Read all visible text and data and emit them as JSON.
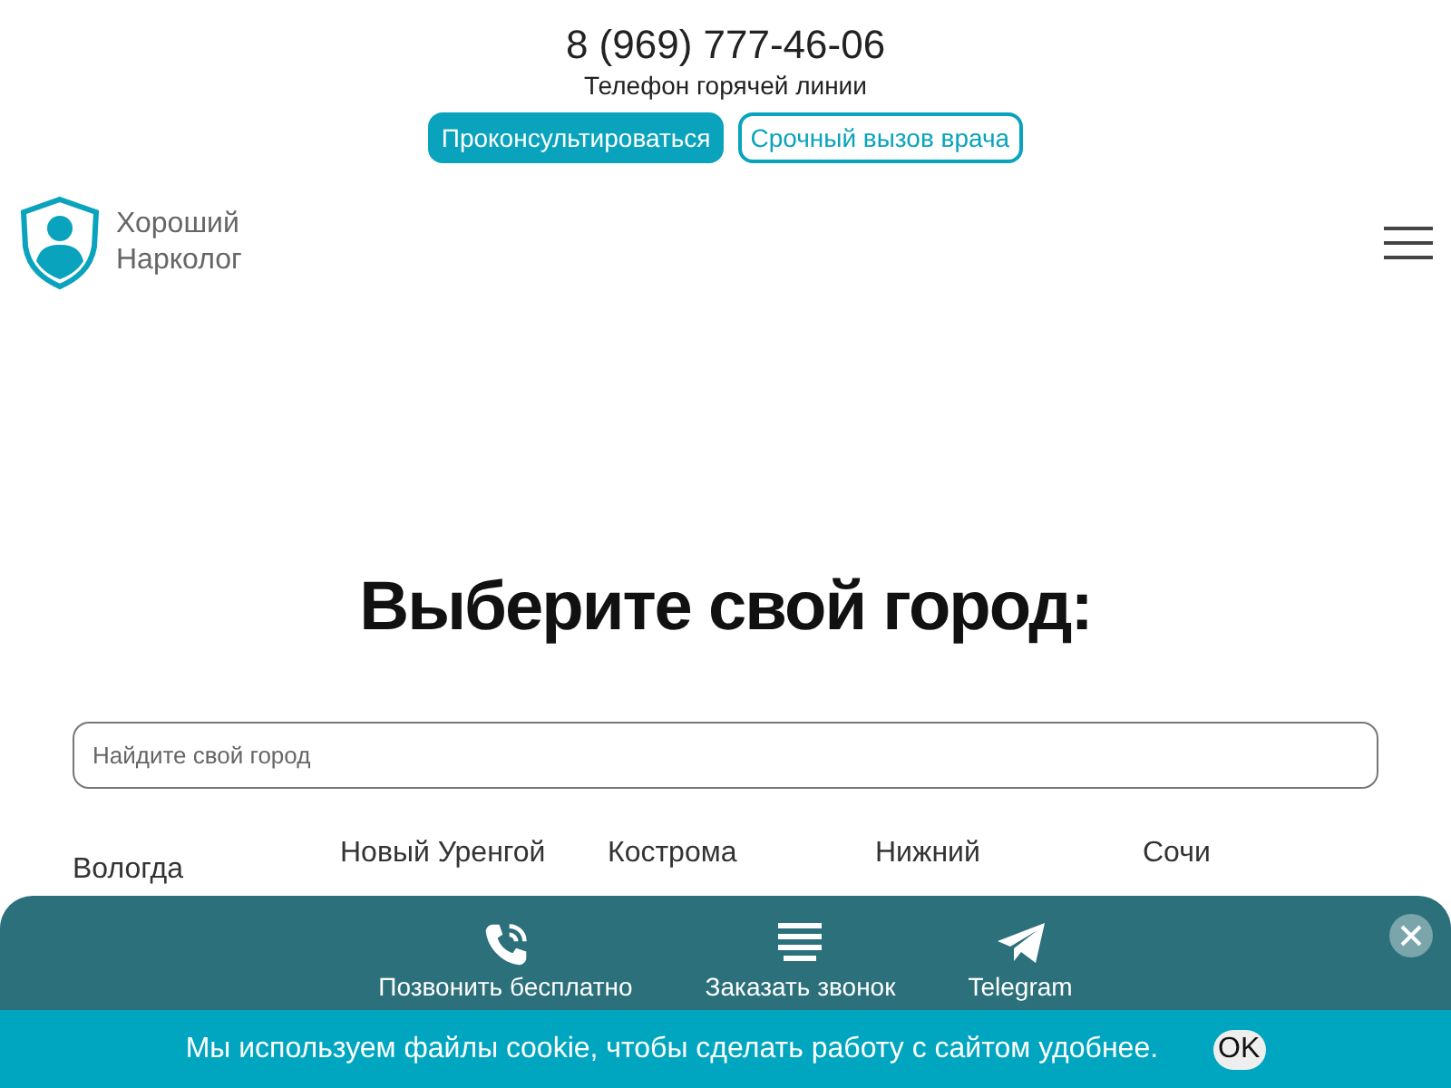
{
  "header": {
    "phone": "8 (969) 777-46-06",
    "phone_caption": "Телефон горячей линии",
    "buttons": [
      {
        "label": "Проконсультироваться",
        "kind": "filled"
      },
      {
        "label": "Срочный вызов врача",
        "kind": "outline"
      }
    ]
  },
  "logo": {
    "name_line_1": "Хороший",
    "name_line_2": "Нарколог"
  },
  "city_picker": {
    "title": "Выберите свой город:",
    "search": {
      "placeholder": "Найдите свой город"
    },
    "cities": [
      "Вологда",
      "Новый Уренгой",
      "Кострома",
      "Нижний",
      "Сочи"
    ]
  },
  "action_panel": {
    "actions": [
      {
        "label": "Позвонить бесплатно",
        "kind": "phone"
      },
      {
        "label": "Заказать звонок",
        "kind": "list"
      },
      {
        "label": "Telegram",
        "kind": "telegram"
      }
    ]
  },
  "cookie_bar": {
    "text": "Мы используем файлы cookie, чтобы сделать работу с сайтом удобнее.",
    "button": "OK"
  }
}
